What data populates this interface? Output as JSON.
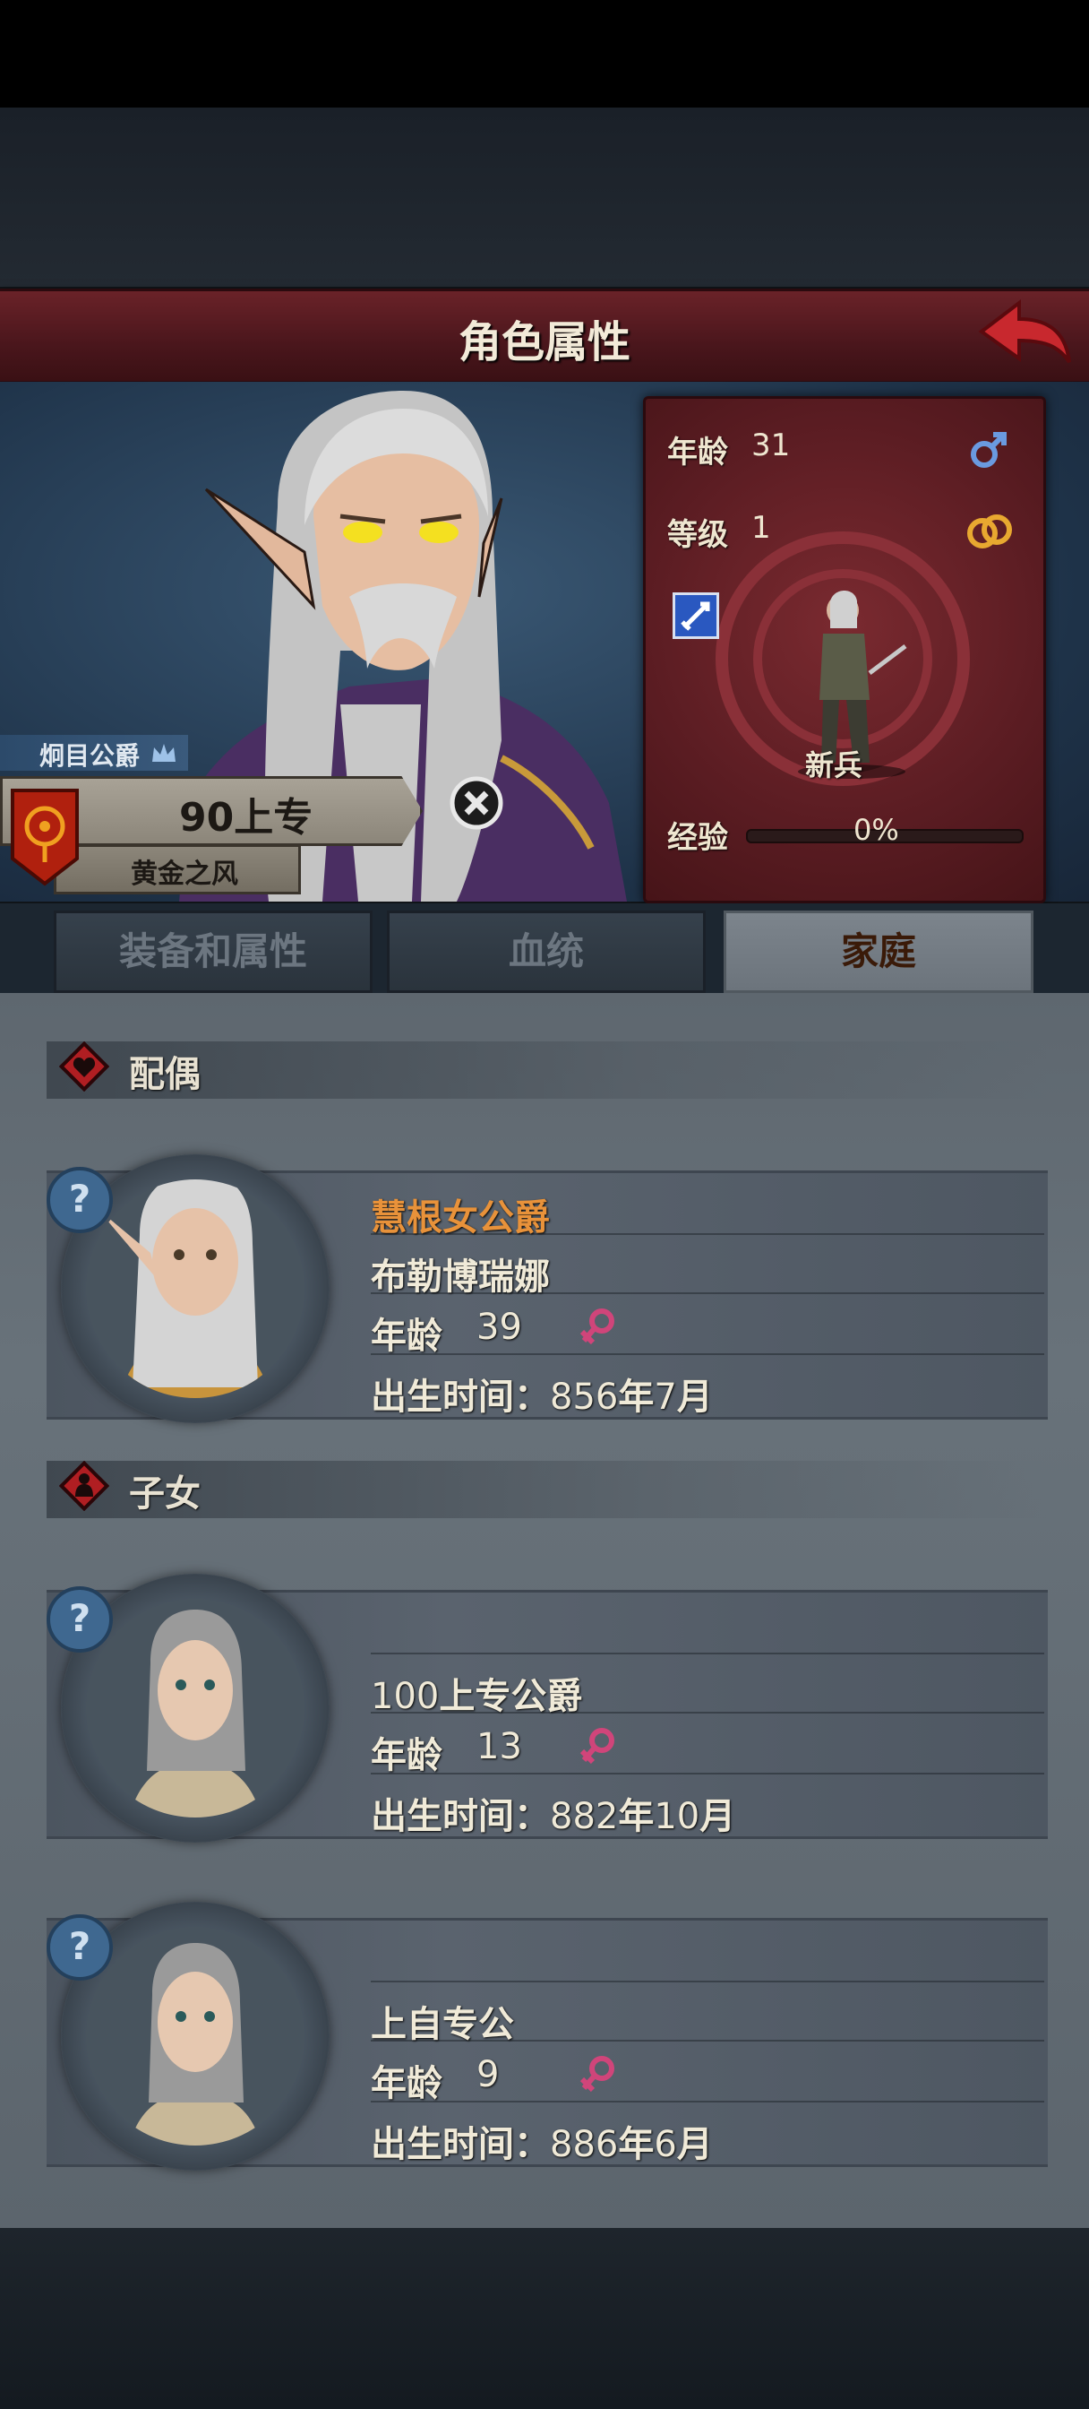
{
  "header": {
    "title": "角色属性",
    "back_icon": "back-arrow-icon"
  },
  "character": {
    "title_rank": "炯目公爵",
    "title_icon": "crown-icon",
    "name": "90上专",
    "house": "黄金之风",
    "unit_type": "新兵",
    "stats": {
      "age_label": "年龄",
      "age": "31",
      "level_label": "等级",
      "level": "1",
      "exp_label": "经验",
      "exp_text": "0%",
      "exp_fraction": 0
    },
    "gender_icon": "male-icon",
    "marriage_icon": "rings-icon",
    "weapon_icon": "sword-icon"
  },
  "tabs": [
    {
      "label": "装备和属性",
      "active": false
    },
    {
      "label": "血统",
      "active": false
    },
    {
      "label": "家庭",
      "active": true
    }
  ],
  "spouse_section": {
    "label": "配偶",
    "icon": "heart-icon",
    "card": {
      "title": "慧根女公爵",
      "title_color": "#e8923a",
      "name": "布勒博瑞娜",
      "age_label": "年龄",
      "age": "39",
      "gender_icon": "female-icon",
      "birth_label": "出生时间：",
      "birth_year": "856",
      "birth_year_unit": "年",
      "birth_month": "7",
      "birth_month_unit": "月"
    }
  },
  "children_section": {
    "label": "子女",
    "icon": "child-icon",
    "cards": [
      {
        "name_num": "100",
        "name_rest": "上专公爵",
        "age_label": "年龄",
        "age": "13",
        "gender_icon": "female-icon",
        "birth_label": "出生时间：",
        "birth_year": "882",
        "birth_year_unit": "年",
        "birth_month": "10",
        "birth_month_unit": "月"
      },
      {
        "name_num": "",
        "name_rest": "上自专公",
        "age_label": "年龄",
        "age": "9",
        "gender_icon": "female-icon",
        "birth_label": "出生时间：",
        "birth_year": "886",
        "birth_year_unit": "年",
        "birth_month": "6",
        "birth_month_unit": "月"
      }
    ]
  },
  "unknown_badge": "?",
  "colors": {
    "accent_red": "#6a2228",
    "female_pink": "#d0457a",
    "male_blue": "#5a8ad0",
    "gold": "#e8923a"
  }
}
